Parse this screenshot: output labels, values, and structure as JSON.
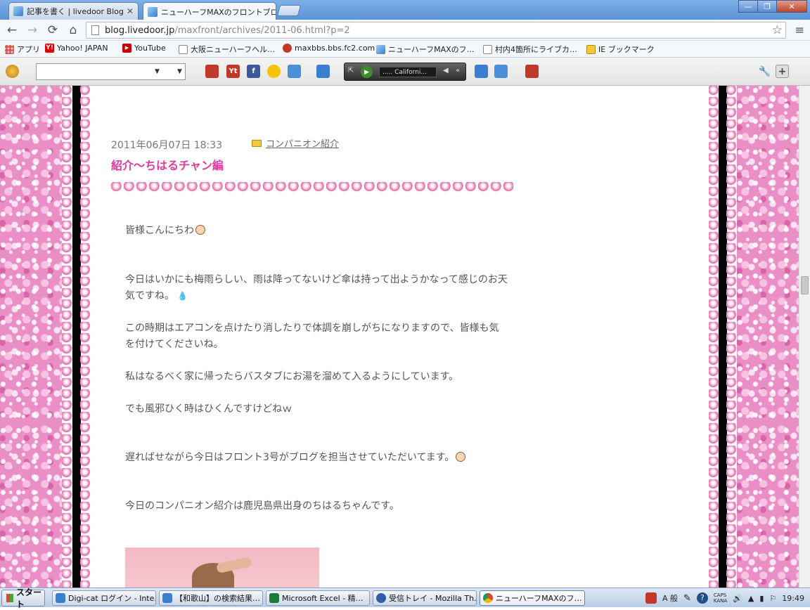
{
  "tabs": [
    {
      "title": "記事を書く | livedoor Blog",
      "active": false
    },
    {
      "title": "ニューハーフMAXのフロントブロ",
      "active": true
    }
  ],
  "window_buttons": {
    "minimize": "—",
    "maximize": "❐",
    "close": "✕"
  },
  "nav": {
    "back": "←",
    "forward": "→",
    "reload": "⟳",
    "home": "⌂",
    "url_host": "blog.livedoor.jp",
    "url_path": "/maxfront/archives/2011-06.html?p=2",
    "star": "☆",
    "menu": "≡"
  },
  "bookmarks": [
    {
      "label": "アプリ",
      "icon": "apps-grid-icon",
      "color": "#d9534f"
    },
    {
      "label": "Yahoo! JAPAN",
      "icon": "yahoo-icon",
      "color": "#e00000"
    },
    {
      "label": "YouTube",
      "icon": "youtube-icon",
      "color": "#cc0000"
    },
    {
      "label": "大阪ニューハーフヘル…",
      "icon": "page-icon",
      "color": "#ffffff"
    },
    {
      "label": "maxbbs.bbs.fc2.com",
      "icon": "fc2-icon",
      "color": "#c0392b"
    },
    {
      "label": "ニューハーフMAXのフ…",
      "icon": "livedoor-icon",
      "color": "#5aa0e0"
    },
    {
      "label": "村内4箇所にライブカ…",
      "icon": "page-icon",
      "color": "#ffffff"
    },
    {
      "label": "IE ブックマーク",
      "icon": "folder-icon",
      "color": "#f3c93a"
    }
  ],
  "player": {
    "station": "..... Californi...",
    "play": "▶",
    "prev": "«",
    "mute": "◀"
  },
  "post": {
    "date": "2011年06月07日 18:33",
    "category": "コンパニオン紹介",
    "title": "紹介〜ちはるチャン編",
    "paragraphs": [
      "皆様こんにちわ",
      "今日はいかにも梅雨らしい、雨は降ってないけど傘は持って出ようかなって感じのお天気ですね。",
      "この時期はエアコンを点けたり消したりで体調を崩しがちになりますので、皆様も気を付けてくださいね。",
      "私はなるべく家に帰ったらバスタブにお湯を溜めて入るようにしています。",
      "でも風邪ひく時はひくんですけどねｗ",
      "遅ればせながら今日はフロント3号がブログを担当させていただいてます。",
      "今日のコンパニオン紹介は鹿児島県出身のちはるちゃんです。"
    ]
  },
  "colors": {
    "title_pink": "#e03a9e",
    "glitter_pink": "#e98fc6",
    "text_gray": "#555555"
  },
  "taskbar": {
    "start": "スタート",
    "tasks": [
      {
        "label": "Digi-cat ログイン - Inte…",
        "color": "#3a7ed0"
      },
      {
        "label": "【和歌山】の検索結果…",
        "color": "#3a7ed0"
      },
      {
        "label": "Microsoft Excel - 精…",
        "color": "#1e7a3a"
      },
      {
        "label": "受信トレイ - Mozilla Th…",
        "color": "#2f5fa8"
      },
      {
        "label": "ニューハーフMAXのフ…",
        "color": "#e0a020"
      }
    ],
    "tray": {
      "ime": "A 般",
      "caps": "CAPS",
      "kana": "KANA",
      "time": "19:49"
    }
  }
}
